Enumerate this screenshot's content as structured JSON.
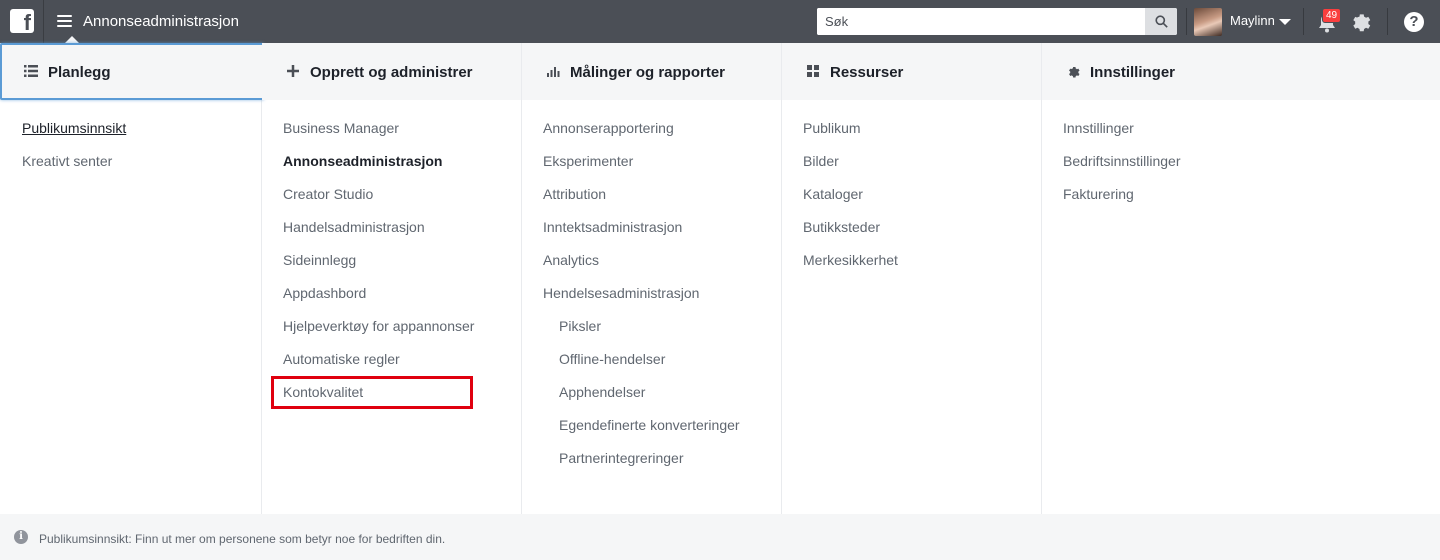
{
  "header": {
    "app_title": "Annonseadministrasjon",
    "search_placeholder": "Søk",
    "username": "Maylinn",
    "notification_count": "49"
  },
  "columns": [
    {
      "title": "Planlegg",
      "icon": "list-icon",
      "items": [
        {
          "label": "Publikumsinnsikt",
          "style": "underline"
        },
        {
          "label": "Kreativt senter"
        }
      ]
    },
    {
      "title": "Opprett og administrer",
      "icon": "plus-icon",
      "items": [
        {
          "label": "Business Manager"
        },
        {
          "label": "Annonseadministrasjon",
          "style": "bold"
        },
        {
          "label": "Creator Studio"
        },
        {
          "label": "Handelsadministrasjon"
        },
        {
          "label": "Sideinnlegg"
        },
        {
          "label": "Appdashbord"
        },
        {
          "label": "Hjelpeverktøy for appannonser"
        },
        {
          "label": "Automatiske regler"
        },
        {
          "label": "Kontokvalitet",
          "style": "highlight"
        }
      ]
    },
    {
      "title": "Målinger og rapporter",
      "icon": "bar-chart-icon",
      "items": [
        {
          "label": "Annonserapportering"
        },
        {
          "label": "Eksperimenter"
        },
        {
          "label": "Attribution"
        },
        {
          "label": "Inntektsadministrasjon"
        },
        {
          "label": "Analytics"
        },
        {
          "label": "Hendelsesadministrasjon"
        },
        {
          "label": "Piksler",
          "sub": true
        },
        {
          "label": "Offline-hendelser",
          "sub": true
        },
        {
          "label": "Apphendelser",
          "sub": true
        },
        {
          "label": "Egendefinerte konverteringer",
          "sub": true
        },
        {
          "label": "Partnerintegreringer",
          "sub": true
        }
      ]
    },
    {
      "title": "Ressurser",
      "icon": "grid-icon",
      "items": [
        {
          "label": "Publikum"
        },
        {
          "label": "Bilder"
        },
        {
          "label": "Kataloger"
        },
        {
          "label": "Butikksteder"
        },
        {
          "label": "Merkesikkerhet"
        }
      ]
    },
    {
      "title": "Innstillinger",
      "icon": "gear-icon",
      "items": [
        {
          "label": "Innstillinger"
        },
        {
          "label": "Bedriftsinnstillinger"
        },
        {
          "label": "Fakturering"
        }
      ]
    }
  ],
  "footer": {
    "text": "Publikumsinnsikt: Finn ut mer om personene som betyr noe for bedriften din."
  },
  "colors": {
    "topbar": "#4b4f56",
    "highlight_box": "#e0000f",
    "active_border": "#5b9bd5",
    "badge": "#fa3e3e"
  }
}
